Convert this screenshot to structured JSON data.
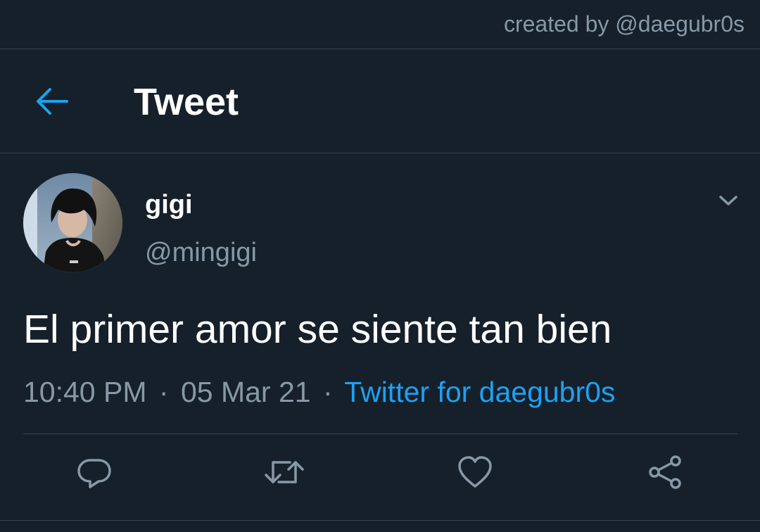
{
  "watermark": {
    "text": "created by @daegubr0s"
  },
  "header": {
    "title": "Tweet",
    "back_icon": "arrow-left-icon"
  },
  "tweet": {
    "author": {
      "name": "gigi",
      "handle": "@mingigi"
    },
    "text": "El primer amor se siente tan bien",
    "time": "10:40 PM",
    "date": "05 Mar 21",
    "separator": "·",
    "source": "Twitter for daegubr0s"
  },
  "actions": [
    {
      "name": "reply",
      "icon": "speech-bubble-icon"
    },
    {
      "name": "retweet",
      "icon": "retweet-icon"
    },
    {
      "name": "like",
      "icon": "heart-icon"
    },
    {
      "name": "share",
      "icon": "share-icon"
    }
  ],
  "colors": {
    "background": "#15202b",
    "accent": "#1da1f2",
    "secondary_text": "#8899a6",
    "divider": "#38444d",
    "primary_text": "#ffffff"
  }
}
